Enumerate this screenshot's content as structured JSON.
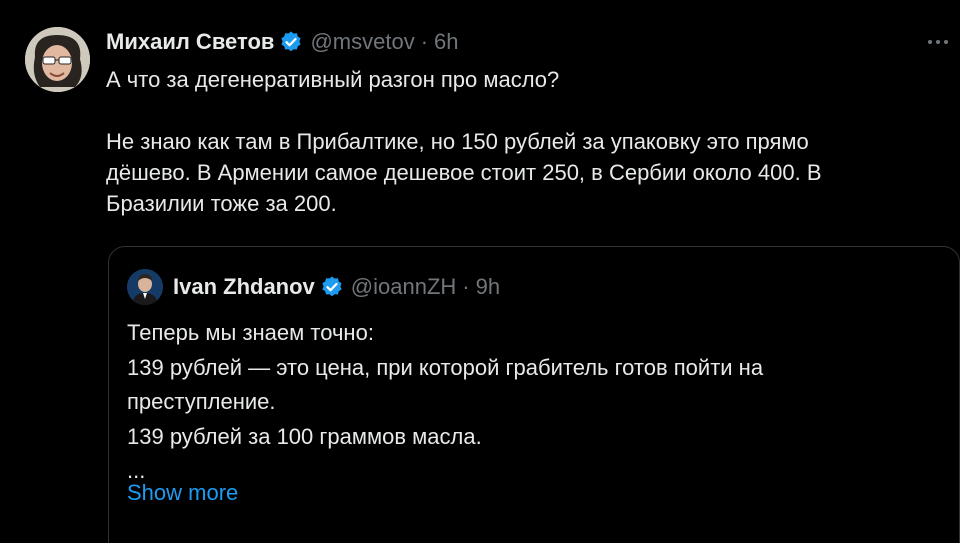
{
  "tweet": {
    "author_name": "Михаил Светов",
    "handle": "@msvetov",
    "separator": "·",
    "time": "6h",
    "avatar_icon": "user-avatar",
    "verified_icon": "verified-badge-icon",
    "more_icon": "more-options-icon",
    "lines": [
      "А что за дегенеративный разгон про масло?",
      "Не знаю как там в Прибалтике, но 150 рублей за упаковку это прямо",
      "дёшево. В Армении самое дешевое стоит 250, в Сербии около 400. В",
      "Бразилии тоже за 200."
    ]
  },
  "quote": {
    "author_name": "Ivan Zhdanov",
    "handle": "@ioannZH",
    "separator": "·",
    "time": "9h",
    "lines": [
      "Теперь мы знаем точно:",
      "139 рублей — это цена, при которой грабитель готов пойти на",
      "преступление.",
      "139 рублей за 100 граммов масла.",
      "..."
    ],
    "show_more_label": "Show more"
  },
  "colors": {
    "background": "#000000",
    "text_primary": "#e7e9ea",
    "text_secondary": "#71767b",
    "accent": "#1d9bf0",
    "border": "#2f3336"
  }
}
